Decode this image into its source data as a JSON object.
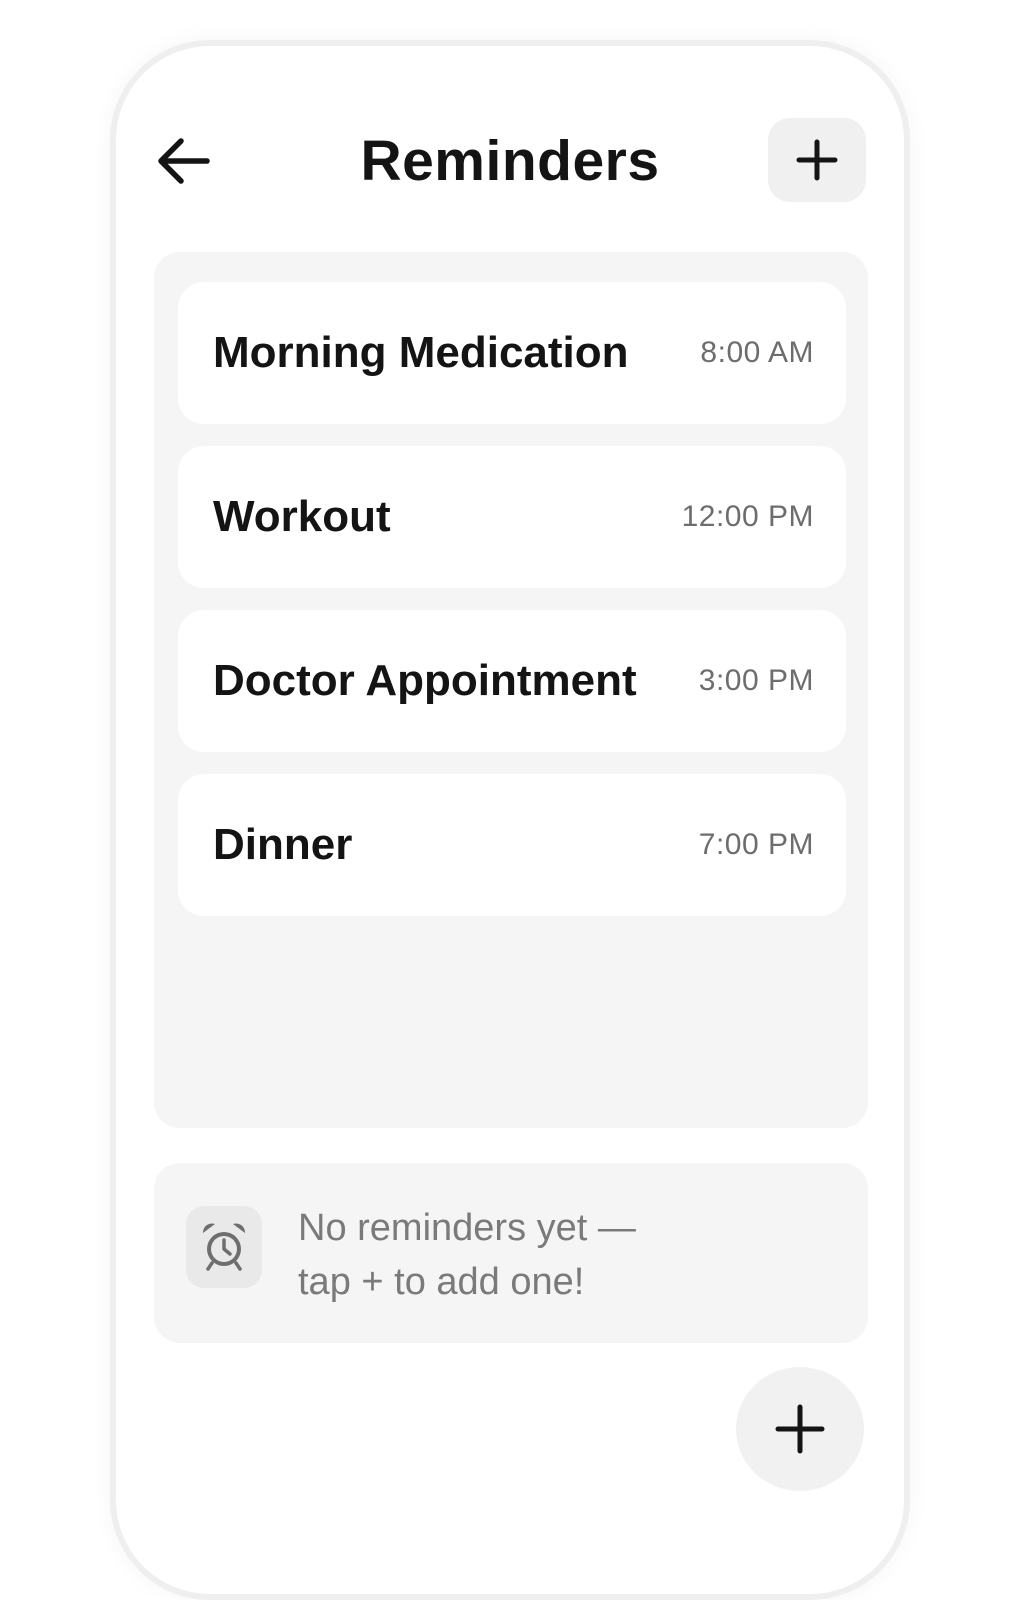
{
  "header": {
    "title": "Reminders",
    "back_icon": "arrow-left-icon",
    "add_icon": "plus-icon"
  },
  "reminders": [
    {
      "title": "Morning Medication",
      "time": "8:00 AM"
    },
    {
      "title": "Workout",
      "time": "12:00 PM"
    },
    {
      "title": "Doctor Appointment",
      "time": "3:00 PM"
    },
    {
      "title": "Dinner",
      "time": "7:00 PM"
    }
  ],
  "empty_state": {
    "icon": "alarm-clock-icon",
    "line1": "No reminders yet —",
    "line2": "tap + to add one!"
  },
  "fab": {
    "icon": "plus-icon"
  },
  "colors": {
    "background": "#ffffff",
    "panel": "#f5f5f5",
    "card": "#ffffff",
    "text_primary": "#141414",
    "text_secondary": "#6d6d6d",
    "icon_button": "#f0f0f0"
  }
}
